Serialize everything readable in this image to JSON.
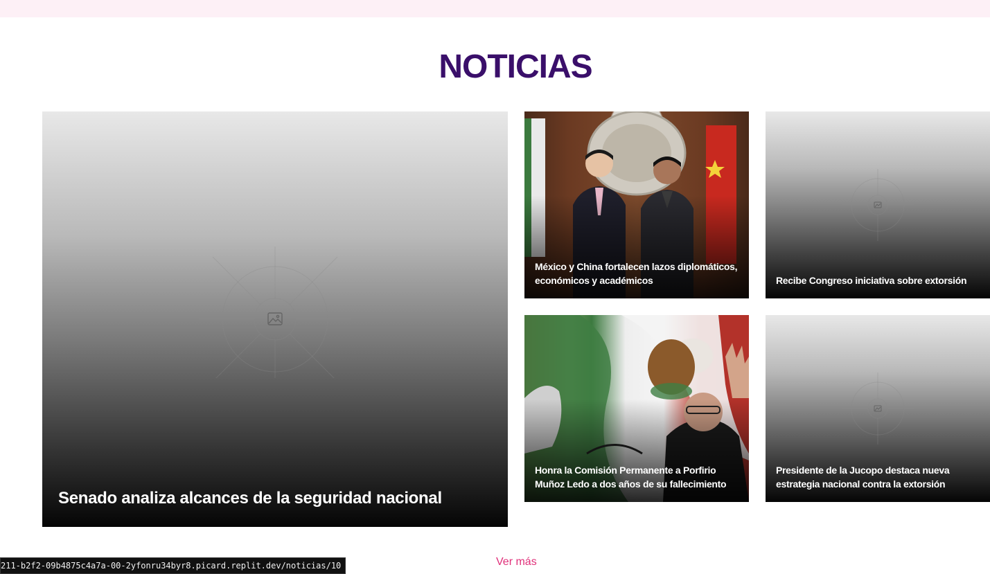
{
  "section": {
    "title": "NOTICIAS"
  },
  "news": {
    "featured": {
      "title": "Senado analiza alcances de la seguridad nacional",
      "image": "placeholder-image"
    },
    "items": [
      {
        "title": "México y China fortalecen lazos diplomáticos, económicos y académicos",
        "image": "photo"
      },
      {
        "title": "Recibe Congreso iniciativa sobre extorsión",
        "image": "placeholder-image"
      },
      {
        "title": "Honra la Comisión Permanente a Porfirio Muñoz Ledo a dos años de su fallecimiento",
        "image": "photo"
      },
      {
        "title": "Presidente de la Jucopo destaca nueva estrategia nacional contra la extorsión",
        "image": "placeholder-image"
      }
    ]
  },
  "footer": {
    "see_more_label": "Ver más"
  },
  "status_bar": {
    "url": "211-b2f2-09b4875c4a7a-00-2yfonru34byr8.picard.replit.dev/noticias/10"
  },
  "colors": {
    "title": "#3a0f6a",
    "link": "#e0307a",
    "top_strip": "#fdf0f6"
  }
}
